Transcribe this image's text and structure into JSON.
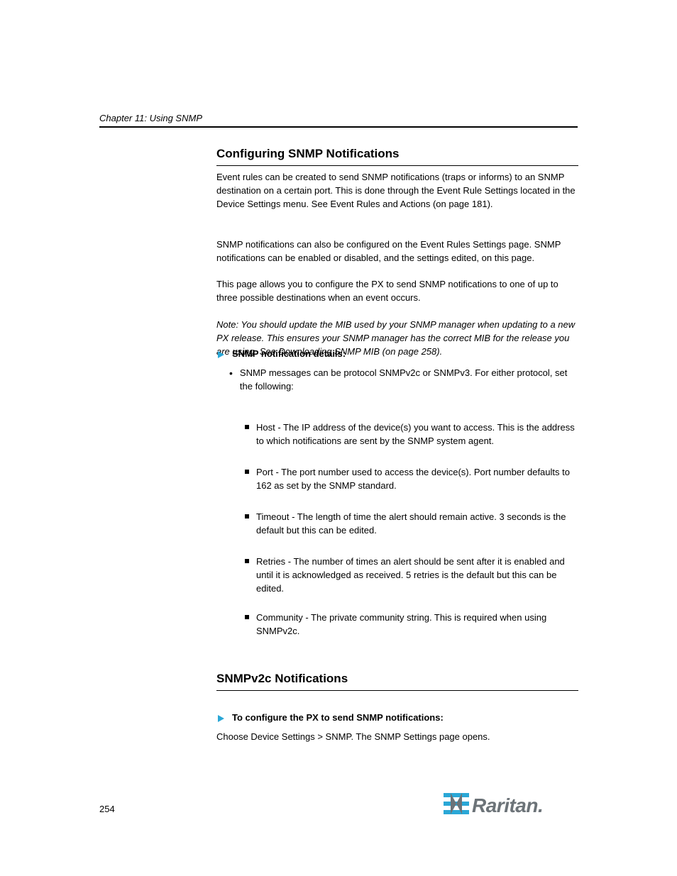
{
  "header": {
    "chapter": "Chapter 11: Using SNMP"
  },
  "section1": {
    "title": "Configuring SNMP Notifications",
    "p1": "Event rules can be created to send SNMP notifications (traps or informs) to an SNMP destination on a certain port. This is done through the Event Rule Settings located in the Device Settings menu. See Event Rules and Actions (on page 181).",
    "p2": "SNMP notifications can also be configured on the Event Rules Settings page. SNMP notifications can be enabled or disabled, and the settings edited, on this page.",
    "p3": "This page allows you to configure the PX to send SNMP notifications to one of up to three possible destinations when an event occurs.",
    "note": "Note: You should update the MIB used by your SNMP manager when updating to a new PX release. This ensures your SNMP manager has the correct MIB for the release you are using. See Downloading SNMP MIB (on page 258)."
  },
  "task1": {
    "label": "SNMP notification details:"
  },
  "bullet": {
    "b1": "SNMP messages can be protocol SNMPv2c or SNMPv3. For either protocol, set the following:"
  },
  "subbullets": {
    "sb1": "Host - The IP address of the device(s) you want to access. This is the address to which notifications are sent by the SNMP system agent.",
    "sb2": "Port - The port number used to access the device(s). Port number defaults to 162 as set by the SNMP standard.",
    "sb3": "Timeout - The length of time the alert should remain active. 3 seconds is the default but this can be edited.",
    "sb4": "Retries - The number of times an alert should be sent after it is enabled and until it is acknowledged as received. 5 retries is the default but this can be edited.",
    "sb5": "Community - The private community string. This is required when using SNMPv2c."
  },
  "section2": {
    "title": "SNMPv2c Notifications",
    "task": "To configure the PX to send SNMP notifications:",
    "p1": "Choose Device Settings > SNMP. The SNMP Settings page opens."
  },
  "footer": {
    "page": "254",
    "brand": "Raritan."
  }
}
